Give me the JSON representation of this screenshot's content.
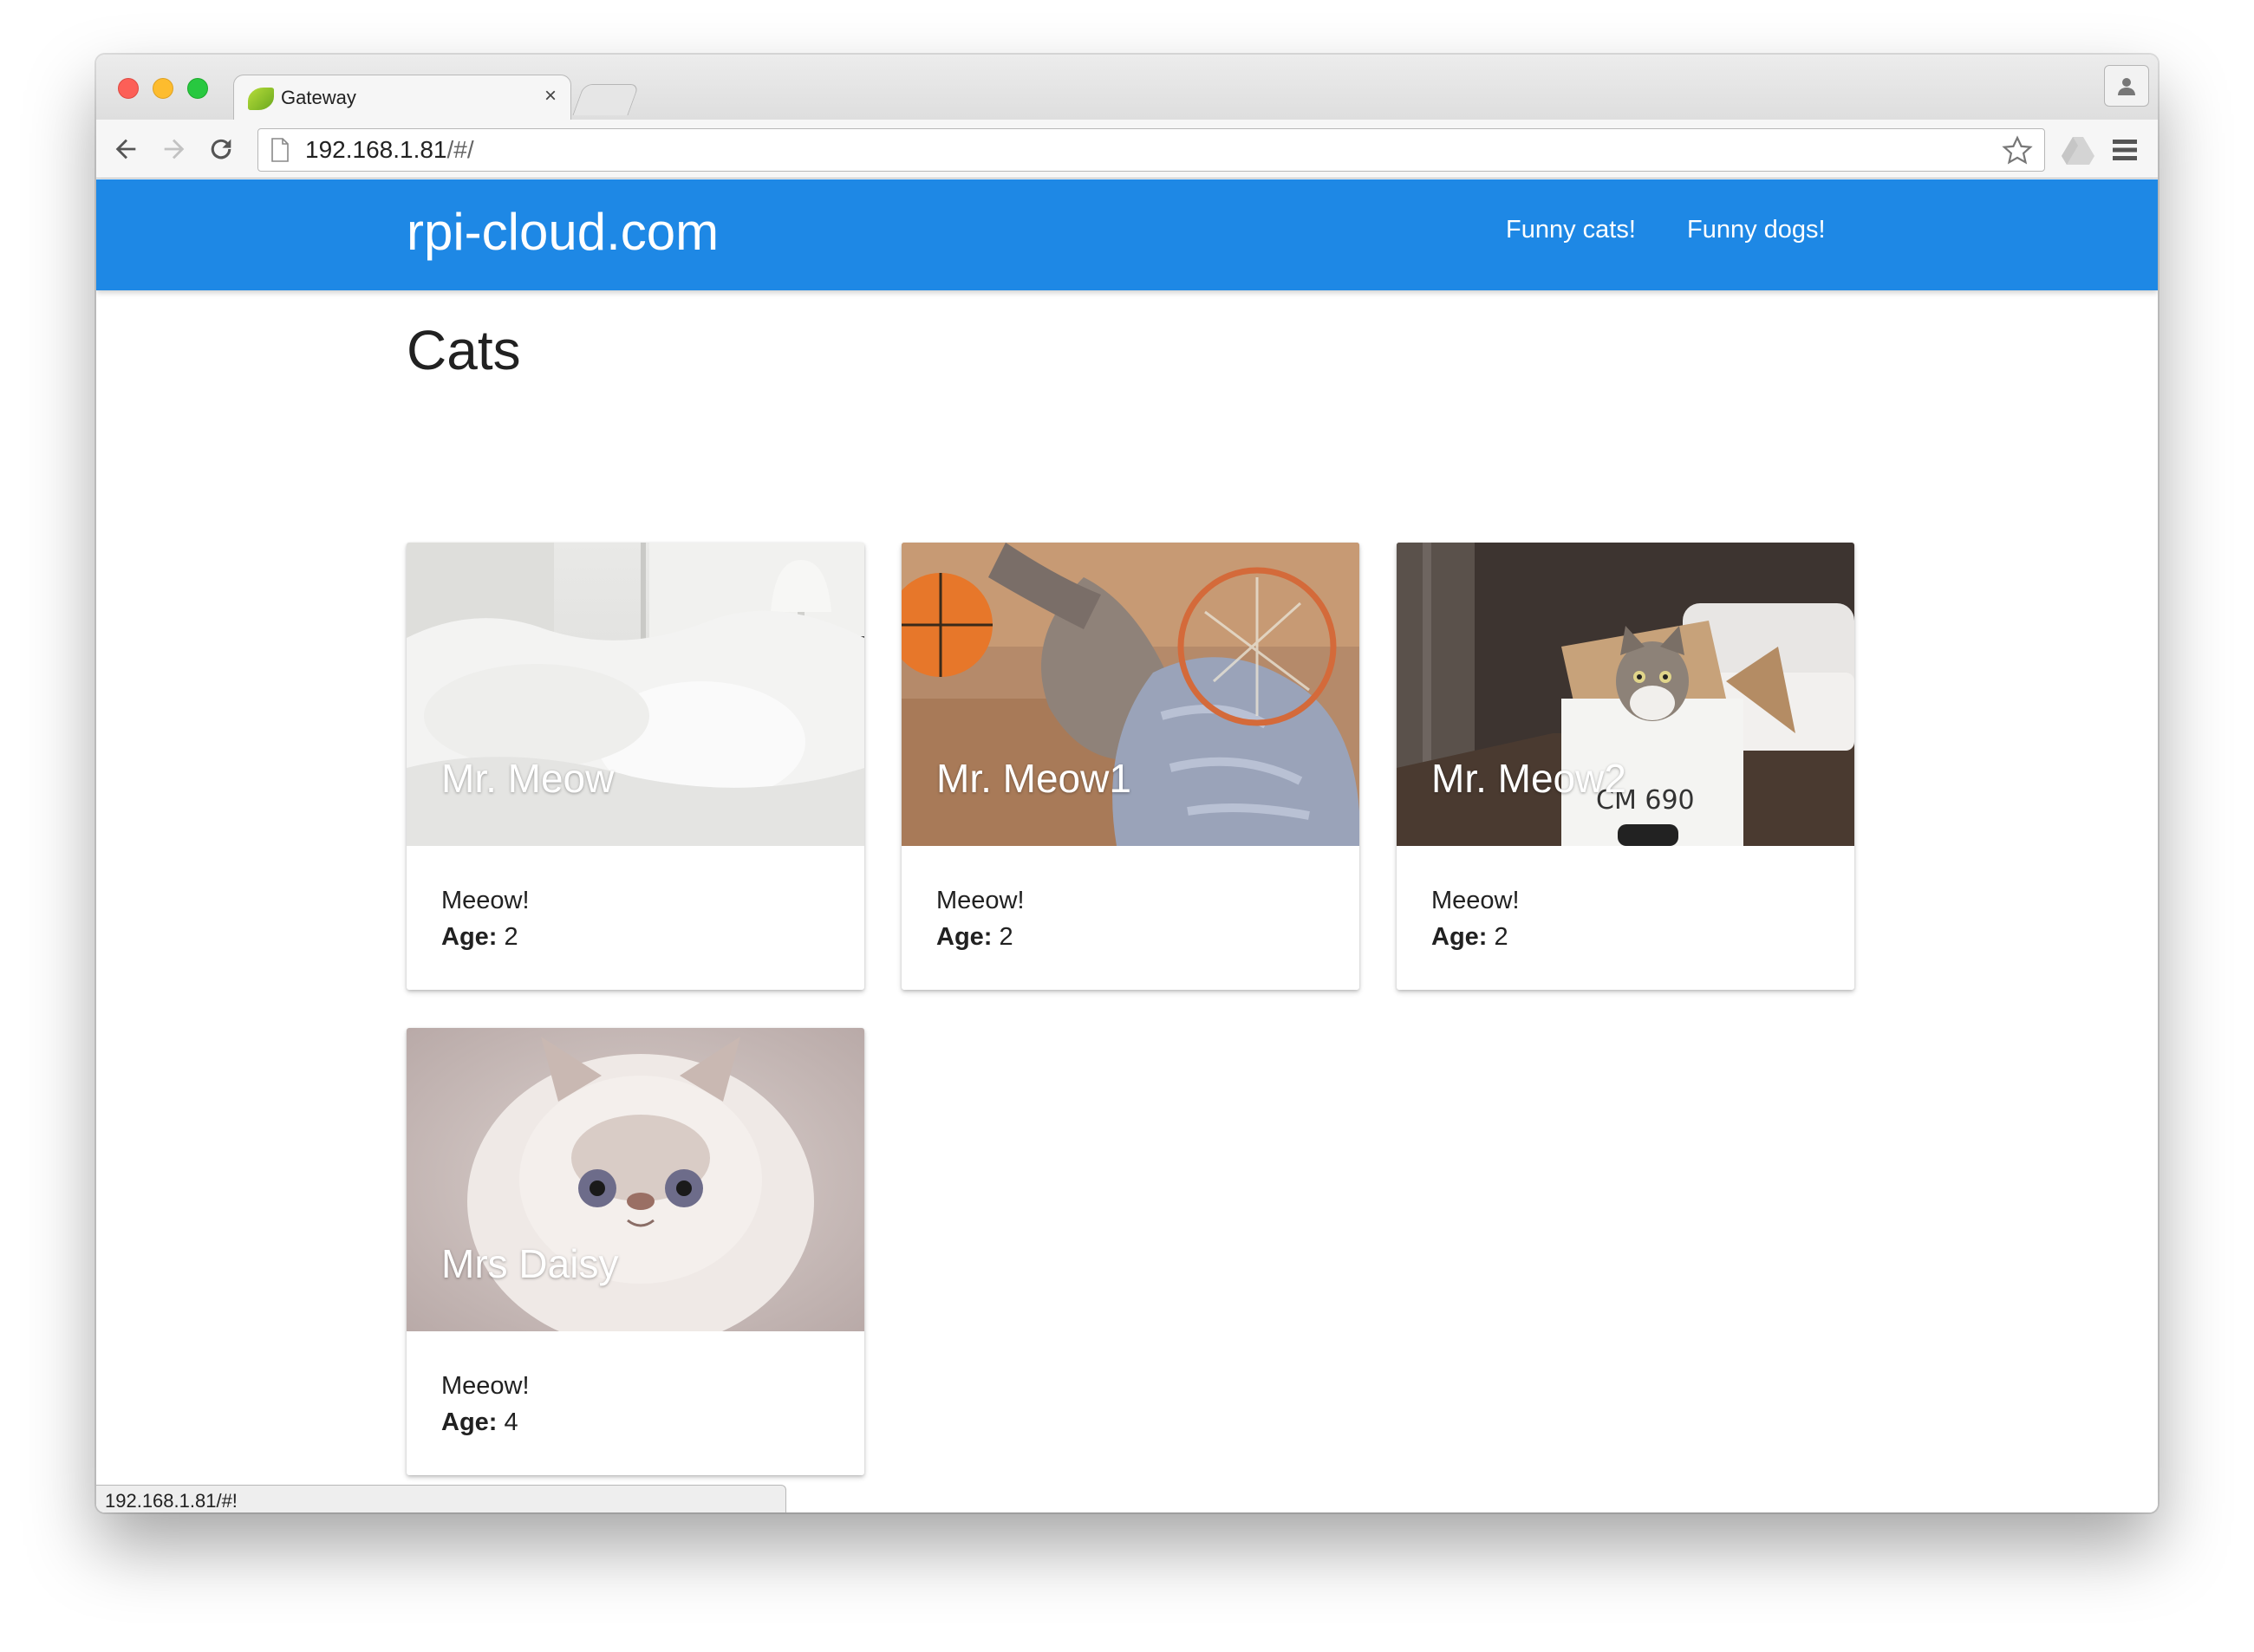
{
  "browser": {
    "tab_title": "Gateway",
    "tab_close": "×",
    "url_host": "192.168.1.81",
    "url_path": "/#/",
    "status_url": "192.168.1.81/#!"
  },
  "site": {
    "brand": "rpi-cloud.com",
    "nav": [
      {
        "label": "Funny cats!"
      },
      {
        "label": "Funny dogs!"
      }
    ],
    "accent_color": "#1e88e5"
  },
  "page": {
    "title": "Cats",
    "cards": [
      {
        "name": "Mr. Meow",
        "description": "Meeow!",
        "age_label": "Age:",
        "age": "2"
      },
      {
        "name": "Mr. Meow1",
        "description": "Meeow!",
        "age_label": "Age:",
        "age": "2"
      },
      {
        "name": "Mr. Meow2",
        "description": "Meeow!",
        "age_label": "Age:",
        "age": "2",
        "box_text": "CM 690"
      },
      {
        "name": "Mrs Daisy",
        "description": "Meeow!",
        "age_label": "Age:",
        "age": "4"
      }
    ]
  }
}
